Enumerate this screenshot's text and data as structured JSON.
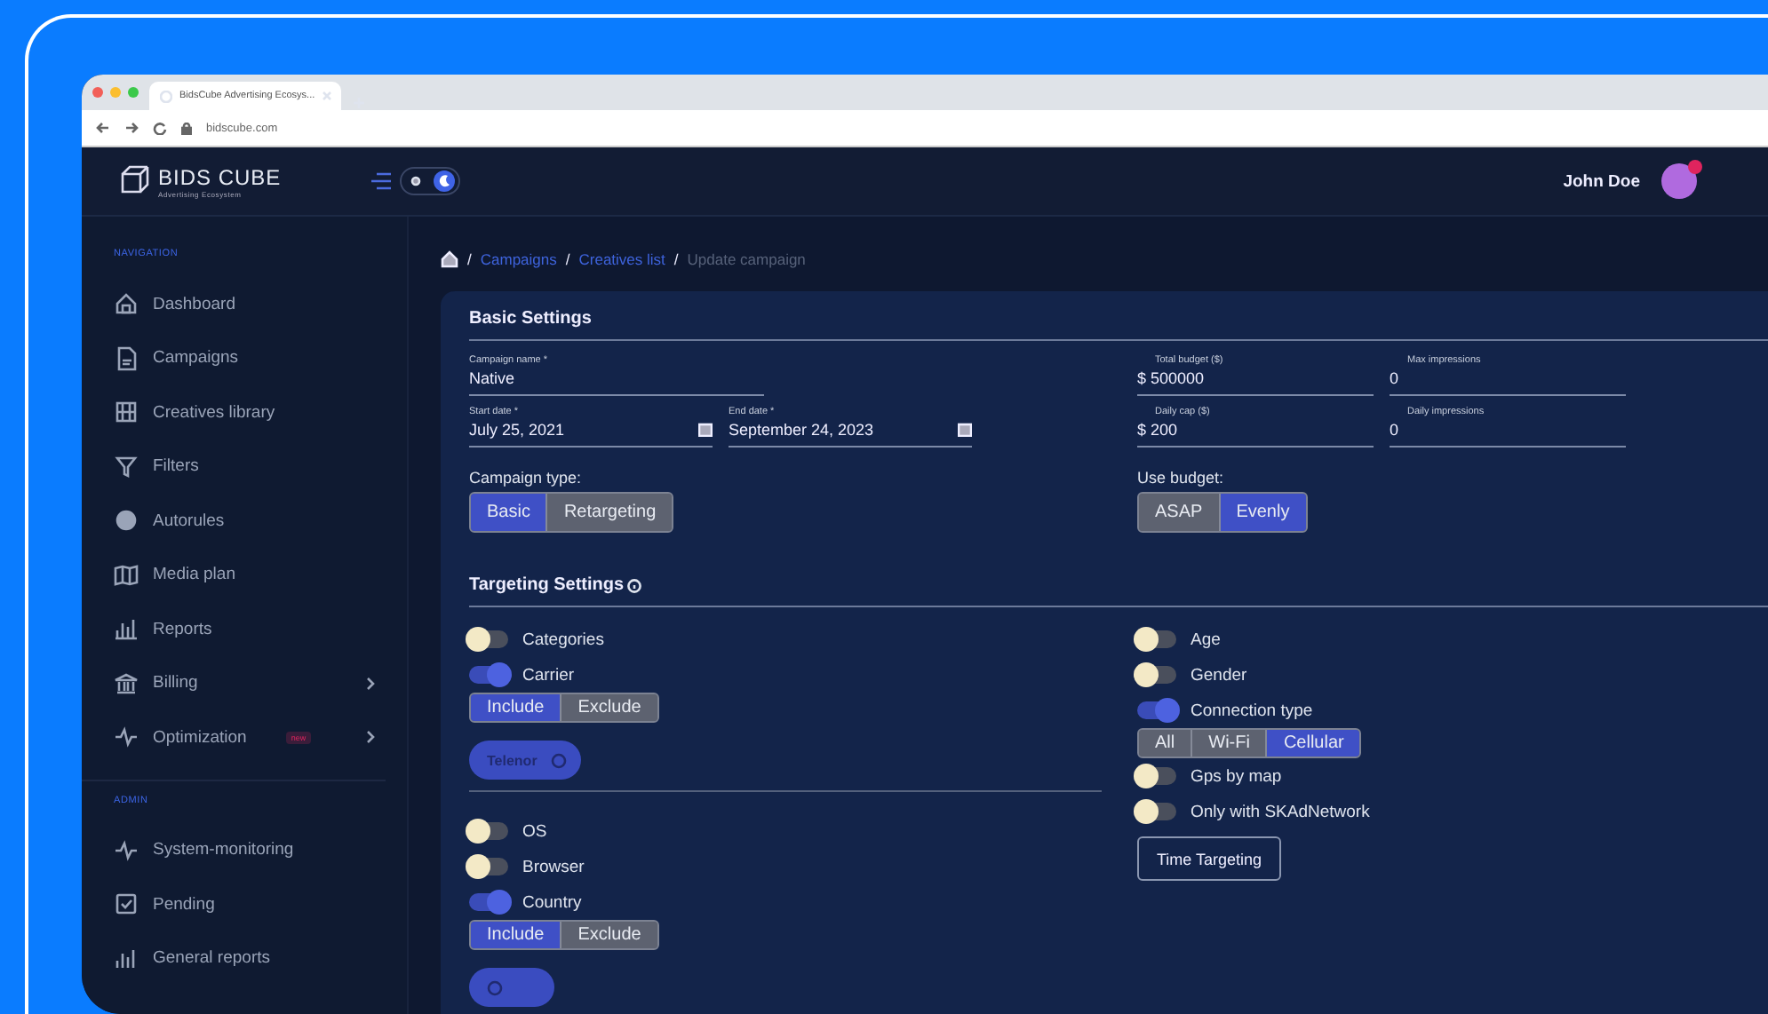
{
  "browser": {
    "tab_title": "BidsCube Advertising Ecosys...",
    "url": "bidscube.com"
  },
  "header": {
    "logo": "BIDS CUBE",
    "logo_tagline": "Advertising Ecosystem",
    "dark_mode": true,
    "user_name": "John Doe"
  },
  "sidebar": {
    "sections": [
      {
        "title": "NAVIGATION",
        "items": [
          {
            "label": "Dashboard",
            "has_submenu": false
          },
          {
            "label": "Campaigns",
            "has_submenu": false
          },
          {
            "label": "Creatives library",
            "has_submenu": false
          },
          {
            "label": "Filters",
            "has_submenu": false
          },
          {
            "label": "Autorules",
            "has_submenu": false
          },
          {
            "label": "Media plan",
            "has_submenu": false
          },
          {
            "label": "Reports",
            "has_submenu": false
          },
          {
            "label": "Billing",
            "has_submenu": true
          },
          {
            "label": "Optimization",
            "has_submenu": true,
            "badge": "new"
          }
        ]
      },
      {
        "title": "ADMIN",
        "items": [
          {
            "label": "System-monitoring",
            "has_submenu": false
          },
          {
            "label": "Pending",
            "has_submenu": false
          },
          {
            "label": "General reports",
            "has_submenu": false
          }
        ]
      }
    ]
  },
  "breadcrumb": [
    {
      "separator": "/",
      "label": "Campaigns",
      "current": false
    },
    {
      "separator": "/",
      "label": "Creatives list",
      "current": false
    },
    {
      "separator": "/",
      "label": "Update campaign",
      "current": true
    }
  ],
  "basic_settings": {
    "title": "Basic Settings",
    "left_fields": [
      {
        "label": "Campaign name *",
        "value": "Native",
        "kind": "text",
        "wide": true
      },
      {
        "label": "Start date *",
        "value": "July 25, 2021",
        "kind": "date",
        "wide": false
      },
      {
        "label": "End date *",
        "value": "September 24, 2023",
        "kind": "date",
        "wide": false
      }
    ],
    "right_fields": [
      {
        "label": "Total budget ($)",
        "value": "$ 500000",
        "kind": "text",
        "wide": false
      },
      {
        "label": "Max impressions",
        "value": "0",
        "kind": "text",
        "wide": false
      },
      {
        "label": "Daily cap ($)",
        "value": "$ 200",
        "kind": "text",
        "wide": false
      },
      {
        "label": "Daily impressions",
        "value": "0",
        "kind": "text",
        "wide": false
      }
    ],
    "campaign_type": {
      "label": "Campaign type:",
      "options": [
        {
          "label": "Basic",
          "selected": true
        },
        {
          "label": "Retargeting",
          "selected": false
        }
      ]
    },
    "use_budget": {
      "label": "Use budget:",
      "options": [
        {
          "label": "ASAP",
          "selected": false
        },
        {
          "label": "Evenly",
          "selected": true
        }
      ]
    }
  },
  "targeting": {
    "title": "Targeting Settings",
    "left_groups": [
      [
        {
          "kind": "toggle",
          "label": "Categories",
          "on": false
        },
        {
          "kind": "toggle",
          "label": "Carrier",
          "on": true
        },
        {
          "kind": "segment",
          "options": [
            {
              "label": "Include",
              "selected": true
            },
            {
              "label": "Exclude",
              "selected": false
            }
          ]
        },
        {
          "kind": "chip",
          "label": "Telenor"
        }
      ],
      [
        {
          "kind": "toggle",
          "label": "OS",
          "on": false
        },
        {
          "kind": "toggle",
          "label": "Browser",
          "on": false
        },
        {
          "kind": "toggle",
          "label": "Country",
          "on": true
        },
        {
          "kind": "segment",
          "options": [
            {
              "label": "Include",
              "selected": true
            },
            {
              "label": "Exclude",
              "selected": false
            }
          ]
        },
        {
          "kind": "chip"
        }
      ]
    ],
    "right_items": [
      {
        "kind": "toggle",
        "label": "Age",
        "on": false
      },
      {
        "kind": "toggle",
        "label": "Gender",
        "on": false
      },
      {
        "kind": "toggle",
        "label": "Connection type",
        "on": true
      },
      {
        "kind": "segment",
        "options": [
          {
            "label": "All",
            "selected": false
          },
          {
            "label": "Wi-Fi",
            "selected": false
          },
          {
            "label": "Cellular",
            "selected": true
          }
        ]
      },
      {
        "kind": "toggle",
        "label": "Gps by map",
        "on": false
      },
      {
        "kind": "toggle",
        "label": "Only with SKAdNetwork",
        "on": false
      },
      {
        "kind": "button",
        "label": "Time Targeting"
      }
    ]
  }
}
